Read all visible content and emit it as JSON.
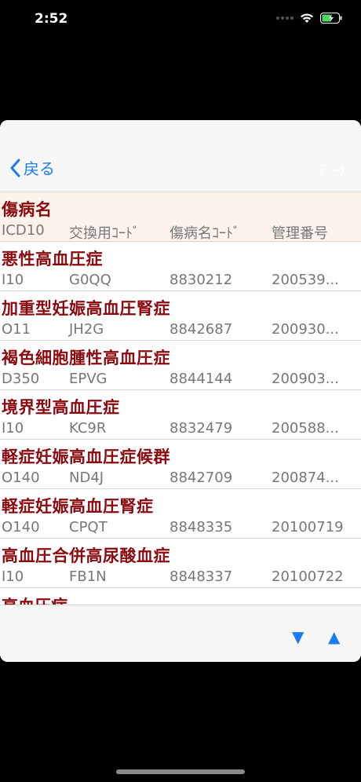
{
  "status_bar": {
    "time": "2:52"
  },
  "nav": {
    "back_label": "戻る",
    "right_label": "ﾃﾞｰﾀ"
  },
  "header_row": {
    "title": "傷病名",
    "cols": [
      "ICD10",
      "交換用ｺｰﾄﾞ",
      "傷病名ｺｰﾄﾞ",
      "管理番号"
    ]
  },
  "rows": [
    {
      "title": "悪性高血圧症",
      "icd10": "I10",
      "exchange_code": "G0QQ",
      "disease_code": "8830212",
      "management_no": "200539..."
    },
    {
      "title": "加重型妊娠高血圧腎症",
      "icd10": "O11",
      "exchange_code": "JH2G",
      "disease_code": "8842687",
      "management_no": "200930..."
    },
    {
      "title": "褐色細胞腫性高血圧症",
      "icd10": "D350",
      "exchange_code": "EPVG",
      "disease_code": "8844144",
      "management_no": "200903..."
    },
    {
      "title": "境界型高血圧症",
      "icd10": "I10",
      "exchange_code": "KC9R",
      "disease_code": "8832479",
      "management_no": "200588..."
    },
    {
      "title": "軽症妊娠高血圧症候群",
      "icd10": "O140",
      "exchange_code": "ND4J",
      "disease_code": "8842709",
      "management_no": "200874..."
    },
    {
      "title": "軽症妊娠高血圧腎症",
      "icd10": "O140",
      "exchange_code": "CPQT",
      "disease_code": "8848335",
      "management_no": "20100719"
    },
    {
      "title": "高血圧合併高尿酸血症",
      "icd10": "I10",
      "exchange_code": "FB1N",
      "disease_code": "8848337",
      "management_no": "20100722"
    }
  ],
  "partial_row_title": "高血圧症",
  "toolbar": {
    "down_label": "▼",
    "up_label": "▲"
  }
}
